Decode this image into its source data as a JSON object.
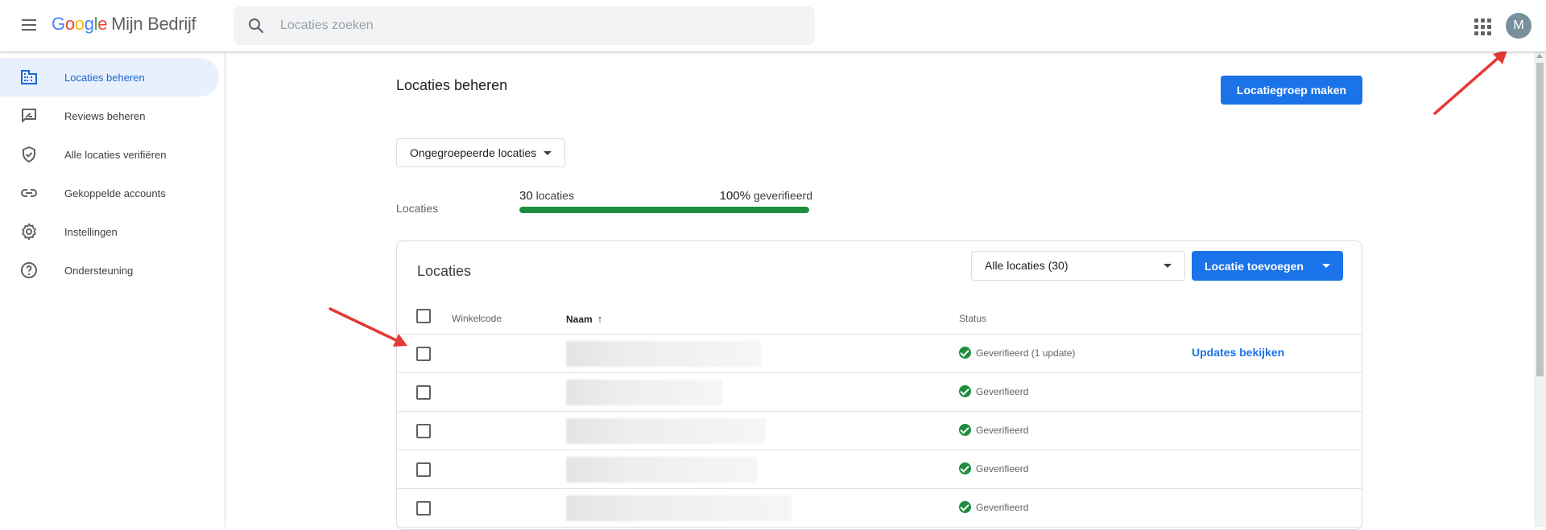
{
  "header": {
    "logo_letters": [
      "G",
      "o",
      "o",
      "g",
      "l",
      "e"
    ],
    "product_name": "Mijn Bedrijf",
    "search_placeholder": "Locaties zoeken",
    "avatar_initial": "M"
  },
  "sidebar": {
    "items": [
      {
        "label": "Locaties beheren",
        "icon": "buildings-icon",
        "active": true
      },
      {
        "label": "Reviews beheren",
        "icon": "rate-review-icon"
      },
      {
        "label": "Alle locaties verifiëren",
        "icon": "verified-shield-icon"
      },
      {
        "label": "Gekoppelde accounts",
        "icon": "link-icon"
      },
      {
        "label": "Instellingen",
        "icon": "gear-icon"
      },
      {
        "label": "Ondersteuning",
        "icon": "help-icon"
      }
    ]
  },
  "main": {
    "title": "Locaties beheren",
    "create_group_button": "Locatiegroep maken",
    "group_select": "Ongegroepeerde locaties",
    "summary": {
      "label": "Locaties",
      "count": "30",
      "count_suffix": "locaties",
      "verified_pct": "100%",
      "verified_suffix": "geverifieerd",
      "progress_fraction": 1.0
    },
    "card": {
      "title": "Locaties",
      "filter_value": "Alle locaties (30)",
      "add_button": "Locatie toevoegen",
      "columns": {
        "store_code": "Winkelcode",
        "name": "Naam",
        "status": "Status"
      },
      "rows": [
        {
          "status": "Geverifieerd (1 update)",
          "action": "Updates bekijken"
        },
        {
          "status": "Geverifieerd",
          "action": ""
        },
        {
          "status": "Geverifieerd",
          "action": ""
        },
        {
          "status": "Geverifieerd",
          "action": ""
        },
        {
          "status": "Geverifieerd",
          "action": ""
        }
      ]
    }
  },
  "colors": {
    "primary": "#1a73e8",
    "success": "#1e8e3e",
    "nav_active_bg": "#e8f0fe",
    "annotation_arrow": "#e53935"
  }
}
